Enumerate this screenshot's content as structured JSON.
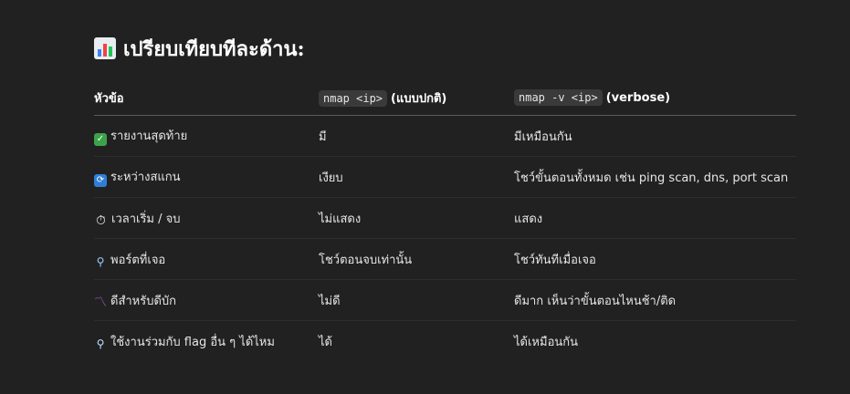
{
  "heading": {
    "icon": "bar-chart-icon",
    "text": "เปรียบเทียบทีละด้าน:"
  },
  "table": {
    "columns": [
      {
        "label": "หัวข้อ"
      },
      {
        "code": "nmap <ip>",
        "label": "(แบบปกติ)"
      },
      {
        "code": "nmap -v <ip>",
        "label": "(verbose)"
      }
    ],
    "rows": [
      {
        "icon": "✅",
        "icon_name": "check-mark-icon",
        "topic": "รายงานสุดท้าย",
        "normal": "มี",
        "verbose": "มีเหมือนกัน"
      },
      {
        "icon": "🔄",
        "icon_name": "cycle-arrows-icon",
        "topic": "ระหว่างสแกน",
        "normal": "เงียบ",
        "verbose": "โชว์ขั้นตอนทั้งหมด เช่น ping scan, dns, port scan"
      },
      {
        "icon": "⏱",
        "icon_name": "stopwatch-icon",
        "topic": "เวลาเริ่ม / จบ",
        "normal": "ไม่แสดง",
        "verbose": "แสดง"
      },
      {
        "icon": "🔍",
        "icon_name": "magnifier-icon",
        "topic": "พอร์ตที่เจอ",
        "normal": "โชว์ตอนจบเท่านั้น",
        "verbose": "โชว์ทันทีเมื่อเจอ"
      },
      {
        "icon": "🐛",
        "icon_name": "bug-icon",
        "topic": "ดีสำหรับดีบัก",
        "normal": "ไม่ดี",
        "verbose": "ดีมาก เห็นว่าขั้นตอนไหนช้า/ติด"
      },
      {
        "icon": "🔎",
        "icon_name": "magnifier-right-icon",
        "topic": "ใช้งานร่วมกับ flag อื่น ๆ ได้ไหม",
        "normal": "ได้",
        "verbose": "ได้เหมือนกัน"
      }
    ]
  },
  "colors": {
    "background": "#212121",
    "text": "#ececec",
    "code_bg": "#3a3a3a"
  }
}
